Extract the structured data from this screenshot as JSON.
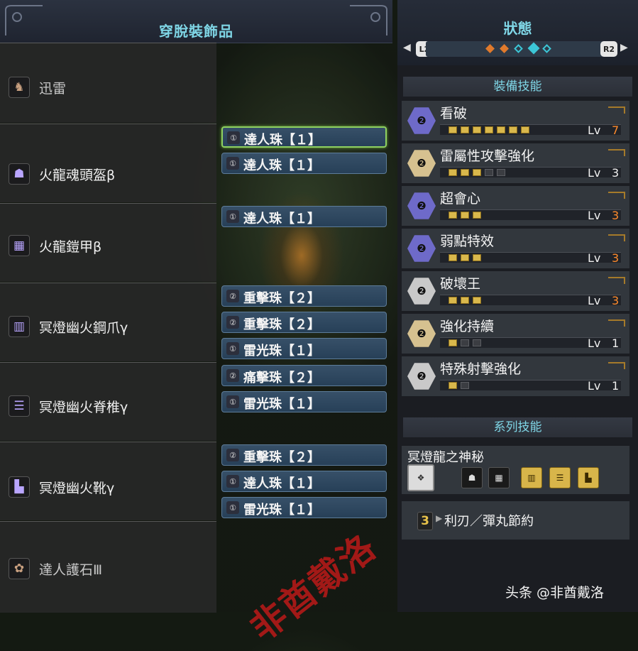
{
  "left_panel": {
    "title": "穿脫裝飾品",
    "equipment": [
      {
        "name": "迅雷",
        "icon": "arms-icon",
        "dim": true,
        "decorations": []
      },
      {
        "name": "火龍魂頭盔β",
        "icon": "helmet-icon",
        "dim": false,
        "decorations": [
          {
            "name": "達人珠【１】",
            "gem": "slot-1-icon",
            "selected": true
          },
          {
            "name": "達人珠【１】",
            "gem": "slot-1-icon",
            "selected": false
          }
        ]
      },
      {
        "name": "火龍鎧甲β",
        "icon": "chest-icon",
        "dim": false,
        "decorations": [
          {
            "name": "達人珠【１】",
            "gem": "slot-1-icon",
            "selected": false
          }
        ]
      },
      {
        "name": "冥燈幽火鋼爪γ",
        "icon": "gauntlet-icon",
        "dim": false,
        "decorations": [
          {
            "name": "重擊珠【２】",
            "gem": "slot-2-icon",
            "selected": false
          },
          {
            "name": "重擊珠【２】",
            "gem": "slot-2-icon",
            "selected": false
          },
          {
            "name": "雷光珠【１】",
            "gem": "slot-1-icon",
            "selected": false
          }
        ]
      },
      {
        "name": "冥燈幽火脊椎γ",
        "icon": "waist-icon",
        "dim": false,
        "decorations": [
          {
            "name": "痛擊珠【２】",
            "gem": "slot-2-icon",
            "selected": false
          },
          {
            "name": "雷光珠【１】",
            "gem": "slot-1-icon",
            "selected": false
          }
        ]
      },
      {
        "name": "冥燈幽火靴γ",
        "icon": "boots-icon",
        "dim": false,
        "decorations": [
          {
            "name": "重擊珠【２】",
            "gem": "slot-2-icon",
            "selected": false
          },
          {
            "name": "達人珠【１】",
            "gem": "slot-1-icon",
            "selected": false
          },
          {
            "name": "雷光珠【１】",
            "gem": "slot-1-icon",
            "selected": false
          }
        ]
      },
      {
        "name": "達人護石Ⅲ",
        "icon": "charm-icon",
        "dim": true,
        "decorations": []
      }
    ]
  },
  "right_panel": {
    "title": "狀態",
    "nav_left": "L2",
    "nav_right": "R2",
    "page_dots": [
      "orange",
      "orange",
      "cyan",
      "cyan-active",
      "cyan"
    ],
    "equip_skills_title": "裝備技能",
    "lv_label": "Lv",
    "skills": [
      {
        "name": "看破",
        "level": 7,
        "max": 7,
        "icon_color": "#6e6ac9",
        "highlight": true
      },
      {
        "name": "雷屬性攻擊強化",
        "level": 3,
        "max": 5,
        "icon_color": "#d6c190",
        "highlight": false
      },
      {
        "name": "超會心",
        "level": 3,
        "max": 3,
        "icon_color": "#6e6ac9",
        "highlight": true
      },
      {
        "name": "弱點特效",
        "level": 3,
        "max": 3,
        "icon_color": "#6e6ac9",
        "highlight": true
      },
      {
        "name": "破壞王",
        "level": 3,
        "max": 3,
        "icon_color": "#c9c9c9",
        "highlight": true
      },
      {
        "name": "強化持續",
        "level": 1,
        "max": 3,
        "icon_color": "#d6c190",
        "highlight": false
      },
      {
        "name": "特殊射擊強化",
        "level": 1,
        "max": 2,
        "icon_color": "#c9c9c9",
        "highlight": false
      }
    ],
    "set_skills_title": "系列技能",
    "set_skill": {
      "name": "冥燈龍之神秘",
      "pieces": [
        {
          "icon": "set-bonus-icon",
          "active": true
        },
        {
          "icon": "helmet-icon",
          "active": false
        },
        {
          "icon": "chest-icon",
          "active": false
        },
        {
          "icon": "gauntlet-icon",
          "active": true
        },
        {
          "icon": "waist-icon",
          "active": true
        },
        {
          "icon": "boots-icon",
          "active": true
        }
      ],
      "effect_count": "3",
      "effect_name": "利刃／彈丸節約"
    }
  },
  "watermark": "非酋戴洛",
  "credit": "头条 @非酋戴洛"
}
